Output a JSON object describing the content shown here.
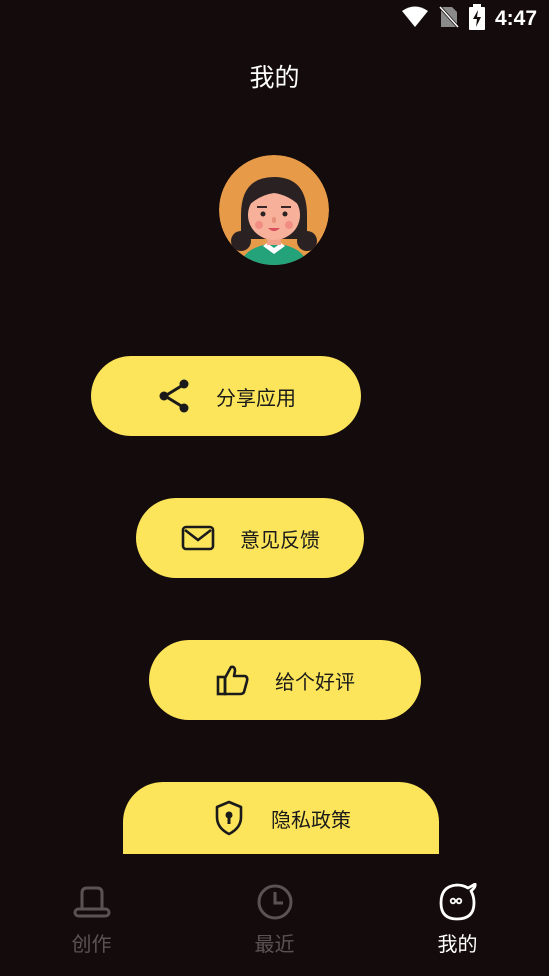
{
  "status_bar": {
    "time": "4:47",
    "icons": [
      "wifi-icon",
      "no-sim-icon",
      "battery-charging-icon"
    ]
  },
  "header": {
    "title": "我的"
  },
  "profile": {
    "avatar": "girl-avatar"
  },
  "menu": {
    "items": [
      {
        "label": "分享应用",
        "icon": "share-icon"
      },
      {
        "label": "意见反馈",
        "icon": "mail-icon"
      },
      {
        "label": "给个好评",
        "icon": "thumbs-up-icon"
      },
      {
        "label": "隐私政策",
        "icon": "shield-lock-icon"
      }
    ]
  },
  "bottom_nav": {
    "items": [
      {
        "label": "创作",
        "icon": "hat-icon",
        "active": false
      },
      {
        "label": "最近",
        "icon": "clock-icon",
        "active": false
      },
      {
        "label": "我的",
        "icon": "face-icon",
        "active": true
      }
    ]
  },
  "colors": {
    "background": "#140b0c",
    "button": "#fce55a",
    "inactive_nav": "#5a5354",
    "active_nav": "#ffffff"
  }
}
